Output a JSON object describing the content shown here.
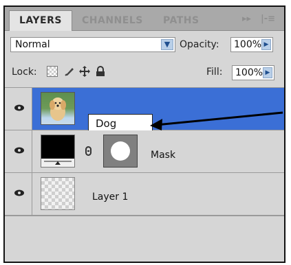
{
  "tabs": [
    "LAYERS",
    "CHANNELS",
    "PATHS"
  ],
  "tab_controls": {
    "collapse": "▸▸",
    "menu": "|-≡"
  },
  "blend_mode": {
    "value": "Normal"
  },
  "opacity": {
    "label": "Opacity:",
    "value": "100%"
  },
  "lock": {
    "label": "Lock:"
  },
  "fill": {
    "label": "Fill:",
    "value": "100%"
  },
  "layers": [
    {
      "name": "Dog",
      "selected": true,
      "visible": true
    },
    {
      "name": "Mask",
      "selected": false,
      "visible": true
    },
    {
      "name": "Layer 1",
      "selected": false,
      "visible": true
    }
  ],
  "colors": {
    "selected_row": "#3b6fd6",
    "panel_bg": "#d6d6d6"
  }
}
